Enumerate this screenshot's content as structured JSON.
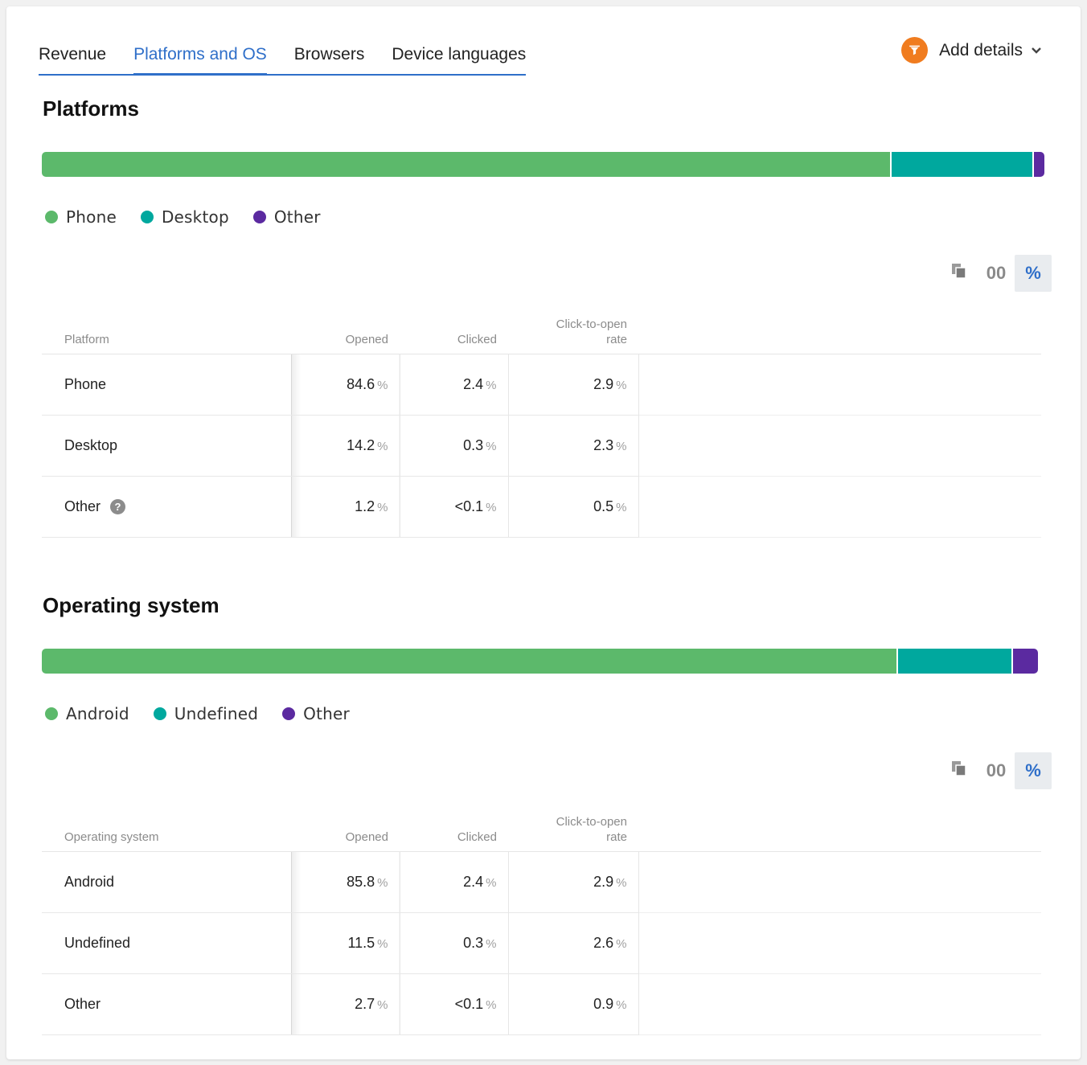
{
  "tabs": [
    {
      "label": "Revenue",
      "active": false
    },
    {
      "label": "Platforms and OS",
      "active": true
    },
    {
      "label": "Browsers",
      "active": false
    },
    {
      "label": "Device languages",
      "active": false
    }
  ],
  "add_details": {
    "label": "Add details",
    "icon": "filter-icon",
    "chevron": "chevron-down-icon"
  },
  "colors": {
    "accent": "#2f6fc9",
    "green": "#5cb96b",
    "teal": "#00a89e",
    "purple": "#5b2aa0",
    "orange": "#f07c1f"
  },
  "view_toggle": {
    "copy_icon": "copy-icon",
    "absolute_label": "00",
    "percent_label": "%",
    "selected": "percent"
  },
  "platforms": {
    "title": "Platforms",
    "distribution": [
      {
        "label": "Phone",
        "share": 84.6,
        "color": "#5cb96b"
      },
      {
        "label": "Desktop",
        "share": 14.2,
        "color": "#00a89e"
      },
      {
        "label": "Other",
        "share": 1.2,
        "color": "#5b2aa0"
      }
    ],
    "columns": [
      "Platform",
      "Opened",
      "Clicked",
      "Click-to-open rate"
    ],
    "rows": [
      {
        "name": "Phone",
        "opened": "84.6",
        "clicked": "2.4",
        "ctor": "2.9",
        "help": false
      },
      {
        "name": "Desktop",
        "opened": "14.2",
        "clicked": "0.3",
        "ctor": "2.3",
        "help": false
      },
      {
        "name": "Other",
        "opened": "1.2",
        "clicked": "<0.1",
        "ctor": "0.5",
        "help": true
      }
    ],
    "unit": "%"
  },
  "os": {
    "title": "Operating system",
    "distribution": [
      {
        "label": "Android",
        "share": 85.8,
        "color": "#5cb96b"
      },
      {
        "label": "Undefined",
        "share": 11.5,
        "color": "#00a89e"
      },
      {
        "label": "Other",
        "share": 2.7,
        "color": "#5b2aa0"
      }
    ],
    "columns": [
      "Operating system",
      "Opened",
      "Clicked",
      "Click-to-open rate"
    ],
    "rows": [
      {
        "name": "Android",
        "opened": "85.8",
        "clicked": "2.4",
        "ctor": "2.9",
        "help": false
      },
      {
        "name": "Undefined",
        "opened": "11.5",
        "clicked": "0.3",
        "ctor": "2.6",
        "help": false
      },
      {
        "name": "Other",
        "opened": "2.7",
        "clicked": "<0.1",
        "ctor": "0.9",
        "help": false
      }
    ],
    "unit": "%"
  },
  "help_glyph": "?"
}
